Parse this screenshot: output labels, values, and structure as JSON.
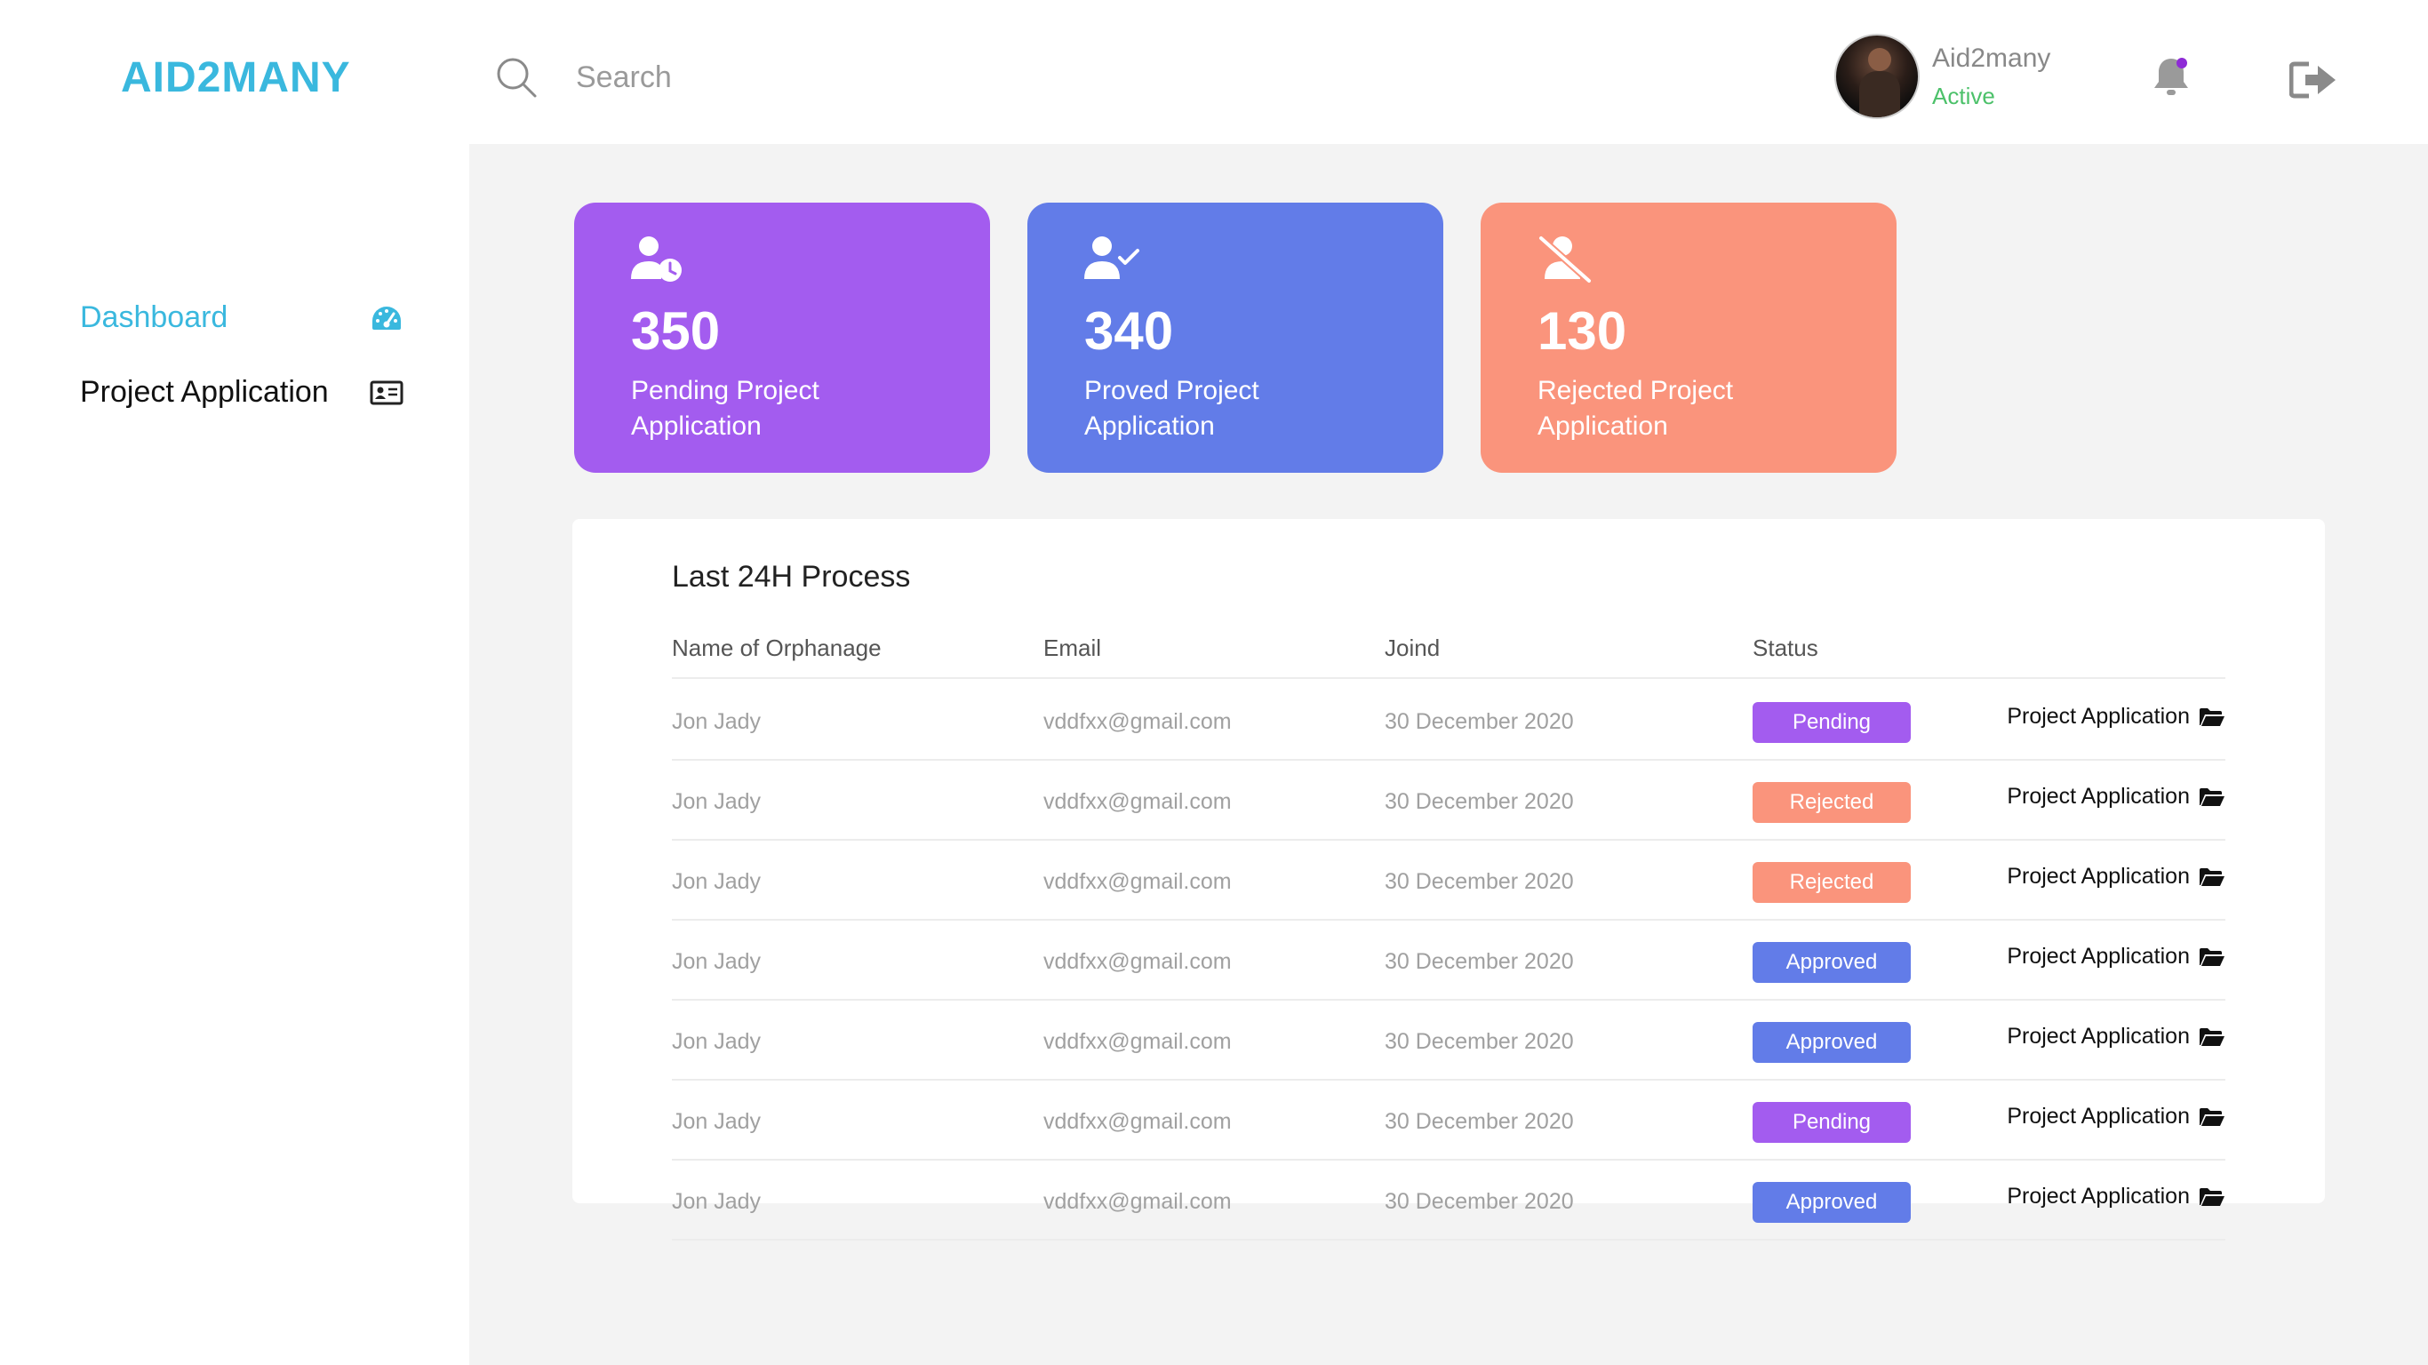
{
  "header": {
    "logo": "AID2MANY",
    "search_placeholder": "Search",
    "user": {
      "name": "Aid2many",
      "status": "Active"
    }
  },
  "sidebar": {
    "items": [
      {
        "label": "Dashboard",
        "icon": "dashboard-gauge-icon",
        "active": true
      },
      {
        "label": "Project Application",
        "icon": "id-card-icon",
        "active": false
      }
    ]
  },
  "cards": [
    {
      "value": "350",
      "label": "Pending Project Application",
      "icon": "user-clock-icon",
      "color": "#a35cef"
    },
    {
      "value": "340",
      "label": "Proved Project Application",
      "icon": "user-check-icon",
      "color": "#627ce8"
    },
    {
      "value": "130",
      "label": "Rejected Project Application",
      "icon": "user-slash-icon",
      "color": "#fa947c"
    }
  ],
  "table": {
    "title": "Last 24H Process",
    "columns": [
      "Name of Orphanage",
      "Email",
      "Joind",
      "Status"
    ],
    "action_label": "Project Application",
    "rows": [
      {
        "name": "Jon Jady",
        "email": "vddfxx@gmail.com",
        "joined": "30 December 2020",
        "status": "Pending"
      },
      {
        "name": "Jon Jady",
        "email": "vddfxx@gmail.com",
        "joined": "30 December 2020",
        "status": "Rejected"
      },
      {
        "name": "Jon Jady",
        "email": "vddfxx@gmail.com",
        "joined": "30 December 2020",
        "status": "Rejected"
      },
      {
        "name": "Jon Jady",
        "email": "vddfxx@gmail.com",
        "joined": "30 December 2020",
        "status": "Approved"
      },
      {
        "name": "Jon Jady",
        "email": "vddfxx@gmail.com",
        "joined": "30 December 2020",
        "status": "Approved"
      },
      {
        "name": "Jon Jady",
        "email": "vddfxx@gmail.com",
        "joined": "30 December 2020",
        "status": "Pending"
      },
      {
        "name": "Jon Jady",
        "email": "vddfxx@gmail.com",
        "joined": "30 December 2020",
        "status": "Approved"
      }
    ]
  },
  "colors": {
    "accent": "#3ab8de",
    "pending": "#a35cef",
    "approved": "#627ce8",
    "rejected": "#fa947c",
    "active": "#4cc16a"
  }
}
